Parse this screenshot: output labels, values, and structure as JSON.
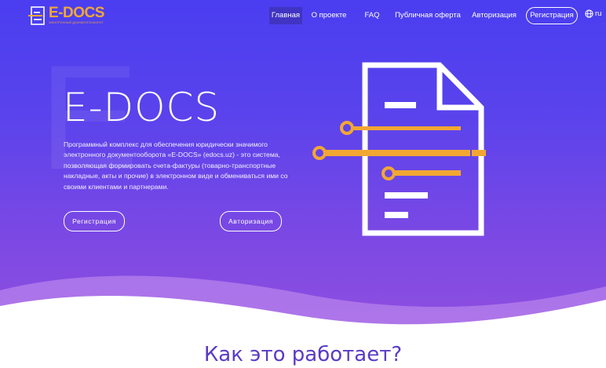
{
  "logo": {
    "text": "E-DOCS",
    "subtitle": "ЭЛЕКТРОННЫЙ ДОКУМЕНТООБОРОТ"
  },
  "nav": {
    "items": [
      "Главная",
      "О проекте",
      "FAQ",
      "Публичная оферта",
      "Авторизация"
    ],
    "register": "Регистрация",
    "lang": "ru"
  },
  "hero": {
    "bg_letter": "E",
    "title": "E-DOCS",
    "description": "Программный комплекс для обеспечения юридически значимого электронного документооборота «E-DOCS» (edocs.uz) - это система, позволяющая формировать счета-фактуры (товарно-транспортные накладные, акты и прочие) в электронном виде и обмениваться ими со своими клиентами и партнерами.",
    "buttons": {
      "register": "Регистрация",
      "login": "Авторизация"
    }
  },
  "section": {
    "title": "Как это работает?"
  },
  "colors": {
    "accent": "#f2a733",
    "hero_start": "#4a3ef0",
    "hero_end": "#8f4fe0",
    "heading": "#5a3bc6"
  }
}
